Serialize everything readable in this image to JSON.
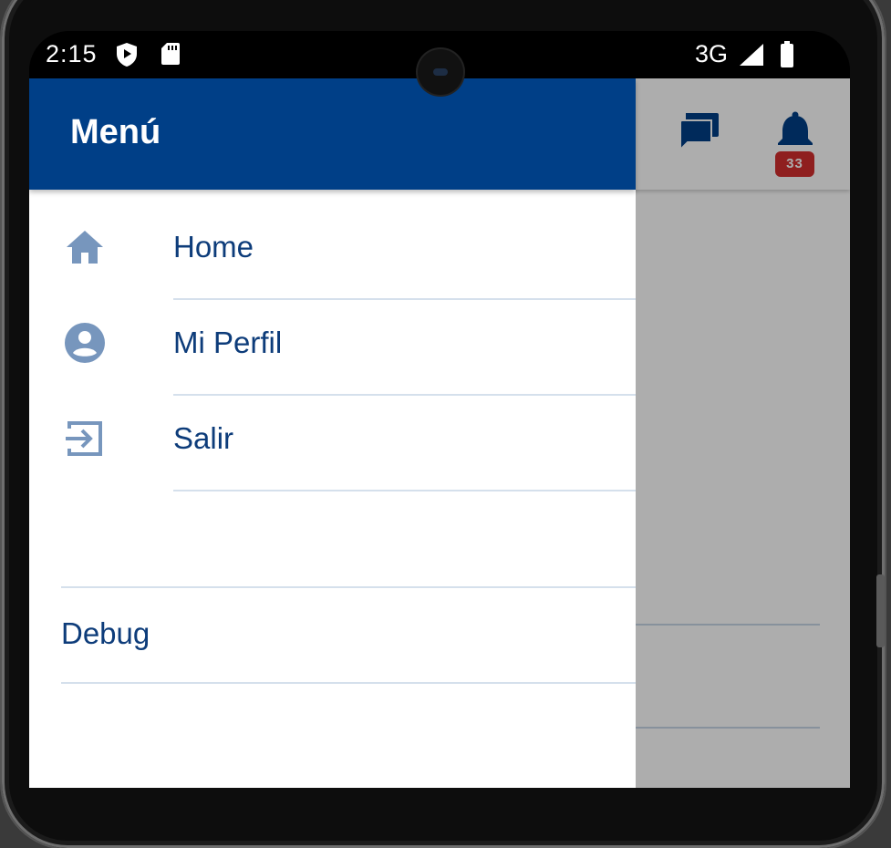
{
  "status_bar": {
    "time": "2:15",
    "network": "3G",
    "icons": [
      "shield-icon",
      "sd-card-icon",
      "signal-icon",
      "battery-icon"
    ]
  },
  "app_header": {
    "icons": [
      "chat-icon",
      "bell-icon"
    ],
    "notification_count": "33"
  },
  "drawer": {
    "title": "Menú",
    "items": [
      {
        "label": "Home",
        "icon": "home-icon"
      },
      {
        "label": "Mi Perfil",
        "icon": "account-circle-icon"
      },
      {
        "label": "Salir",
        "icon": "logout-icon"
      }
    ],
    "debug_label": "Debug"
  },
  "colors": {
    "header": "#003f87",
    "text": "#0d3c7a",
    "icon": "#7796bd",
    "badge": "#d32f2f",
    "divider": "#d5e0ec"
  }
}
